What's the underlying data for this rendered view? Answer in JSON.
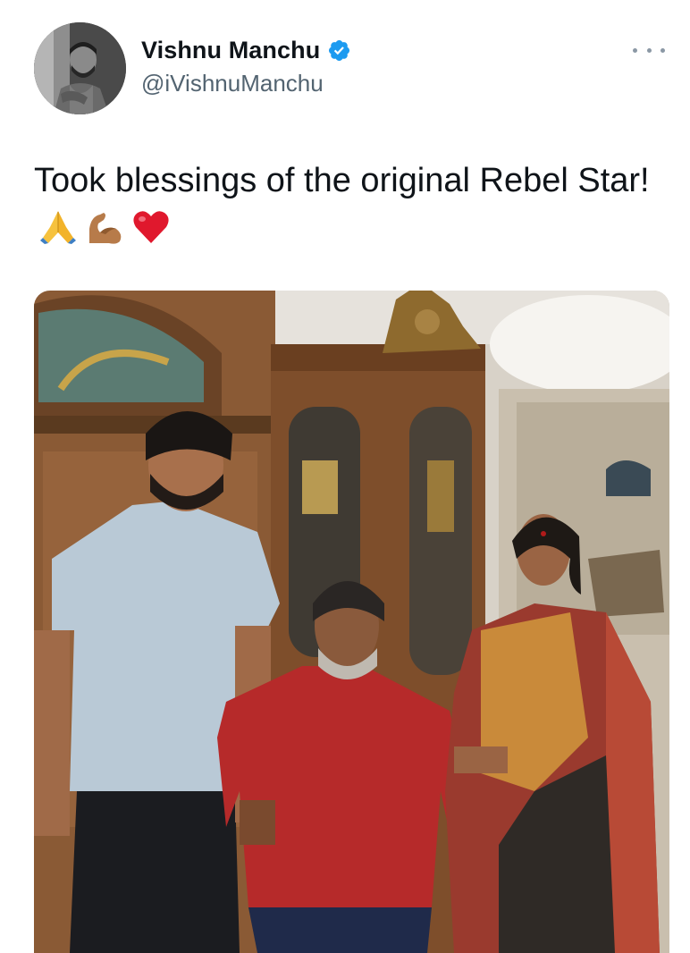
{
  "author": {
    "display_name": "Vishnu Manchu",
    "handle": "@iVishnuManchu",
    "verified": true,
    "avatar_icon": "profile-photo-avatar"
  },
  "tweet": {
    "text": "Took blessings of the original Rebel Star!",
    "emojis": [
      "folded-hands-emoji",
      "flexed-biceps-emoji",
      "red-heart-emoji"
    ]
  },
  "media": {
    "type": "photo"
  },
  "icons": {
    "more": "more-options-icon",
    "verified": "verified-badge-icon"
  },
  "colors": {
    "verified_blue": "#1d9bf0",
    "text_primary": "#0f1419",
    "text_secondary": "#536471"
  }
}
